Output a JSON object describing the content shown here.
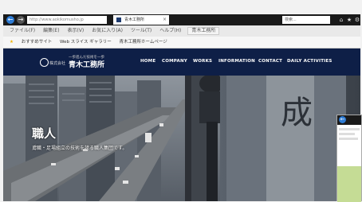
{
  "browser": {
    "back_symbol": "←",
    "fwd_symbol": "→",
    "address": "http://www.aokikomusho.jp",
    "tab_title": "青木工務所",
    "tab_close": "×",
    "search_placeholder": "検索...",
    "icons": [
      "home-icon",
      "star-icon",
      "gear-icon"
    ],
    "icon_glyphs": {
      "home": "⌂",
      "star": "★",
      "gear": "⚙"
    }
  },
  "menubar": {
    "items": [
      "ファイル(F)",
      "編集(E)",
      "表示(V)",
      "お気に入り(A)",
      "ツール(T)",
      "ヘルプ(H)"
    ],
    "tab_label": "青木工務所"
  },
  "favorites": {
    "items": [
      "おすすめサイト",
      "Web スライス ギャラリー",
      "青木工務所ホームページ"
    ]
  },
  "site": {
    "logo_prefix": "株式会社",
    "logo_tagline": "一歩進んだ技術を一歩",
    "logo_name": "青木工務所",
    "nav": [
      "HOME",
      "COMPANY",
      "WORKS",
      "INFORMATION",
      "CONTACT",
      "DAILY ACTIVITIES"
    ]
  },
  "hero": {
    "title": "職人",
    "subtitle": "鳶職・足場組立の技術を誇る職人集団です。",
    "background_color": "#4c535c",
    "sign_character": "成"
  },
  "colors": {
    "header_bg": "#0e1f47",
    "chrome_dark": "#1a1a1a",
    "accent_blue": "#2d7bd4"
  }
}
